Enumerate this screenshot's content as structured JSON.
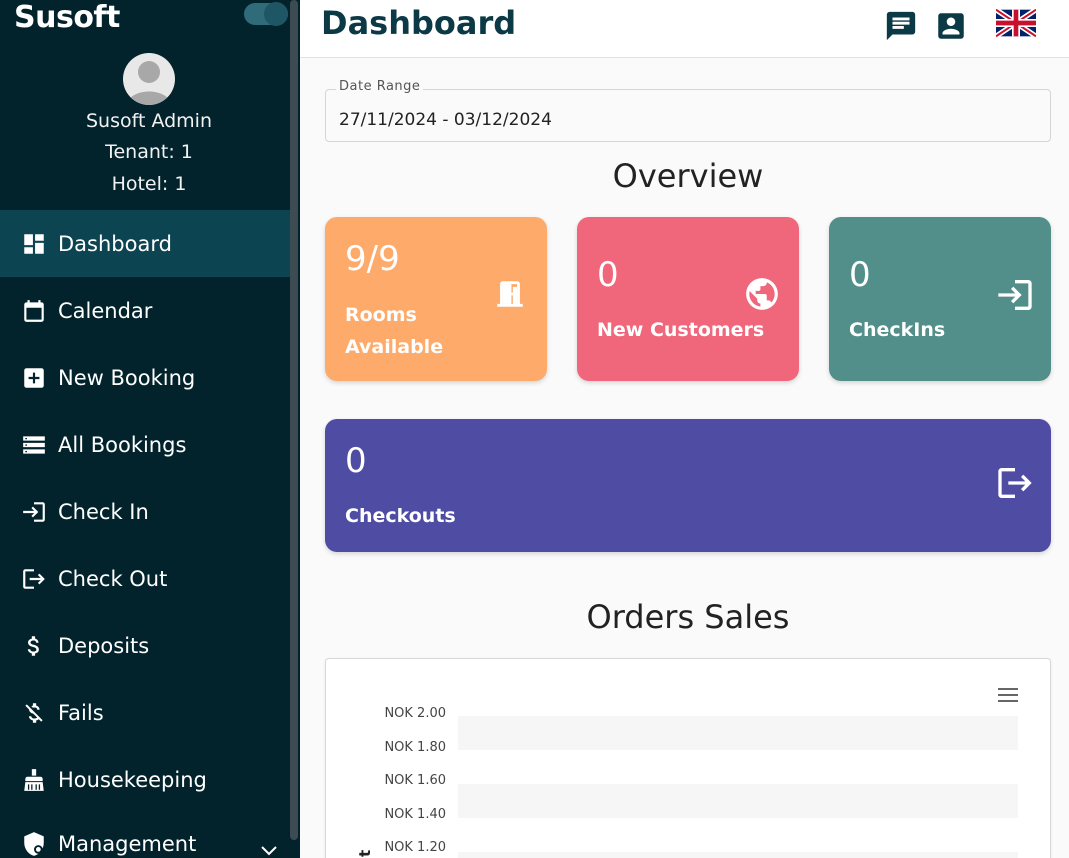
{
  "brand": "Susoft",
  "user": {
    "name": "Susoft Admin",
    "tenant": "Tenant: 1",
    "hotel": "Hotel: 1"
  },
  "nav": {
    "items": [
      {
        "label": "Dashboard",
        "icon": "dashboard-icon"
      },
      {
        "label": "Calendar",
        "icon": "calendar-icon"
      },
      {
        "label": "New Booking",
        "icon": "add-box-icon"
      },
      {
        "label": "All Bookings",
        "icon": "list-icon"
      },
      {
        "label": "Check In",
        "icon": "login-icon"
      },
      {
        "label": "Check Out",
        "icon": "logout-icon"
      },
      {
        "label": "Deposits",
        "icon": "dollar-icon"
      },
      {
        "label": "Fails",
        "icon": "money-off-icon"
      },
      {
        "label": "Housekeeping",
        "icon": "broom-icon"
      },
      {
        "label": "Management",
        "icon": "shield-settings-icon"
      }
    ]
  },
  "header": {
    "title": "Dashboard",
    "icons": [
      "chat-icon",
      "account-box-icon",
      "uk-flag-icon"
    ]
  },
  "date_range": {
    "label": "Date Range",
    "value": "27/11/2024 - 03/12/2024"
  },
  "overview": {
    "title": "Overview",
    "cards": [
      {
        "value": "9/9",
        "label_line1": "Rooms",
        "label_line2": "Available",
        "color": "#fdaa6a",
        "icon": "door-icon"
      },
      {
        "value": "0",
        "label": "New Customers",
        "color": "#f0677b",
        "icon": "globe-icon"
      },
      {
        "value": "0",
        "label": "CheckIns",
        "color": "#528f8b",
        "icon": "login-icon"
      },
      {
        "value": "0",
        "label": "Checkouts",
        "color": "#4e4ca3",
        "icon": "logout-icon"
      }
    ]
  },
  "orders_sales": {
    "title": "Orders Sales",
    "menu_icon": "hamburger-menu-icon",
    "y_ticks": [
      "NOK 2.00",
      "NOK 1.80",
      "NOK 1.60",
      "NOK 1.40",
      "NOK 1.20"
    ],
    "y_axis_label_fragment": "t"
  },
  "colors": {
    "sidebar_bg": "#02232c",
    "active_item_bg": "#0d4452",
    "accent": "#f06c7b",
    "title": "#0c3946"
  }
}
